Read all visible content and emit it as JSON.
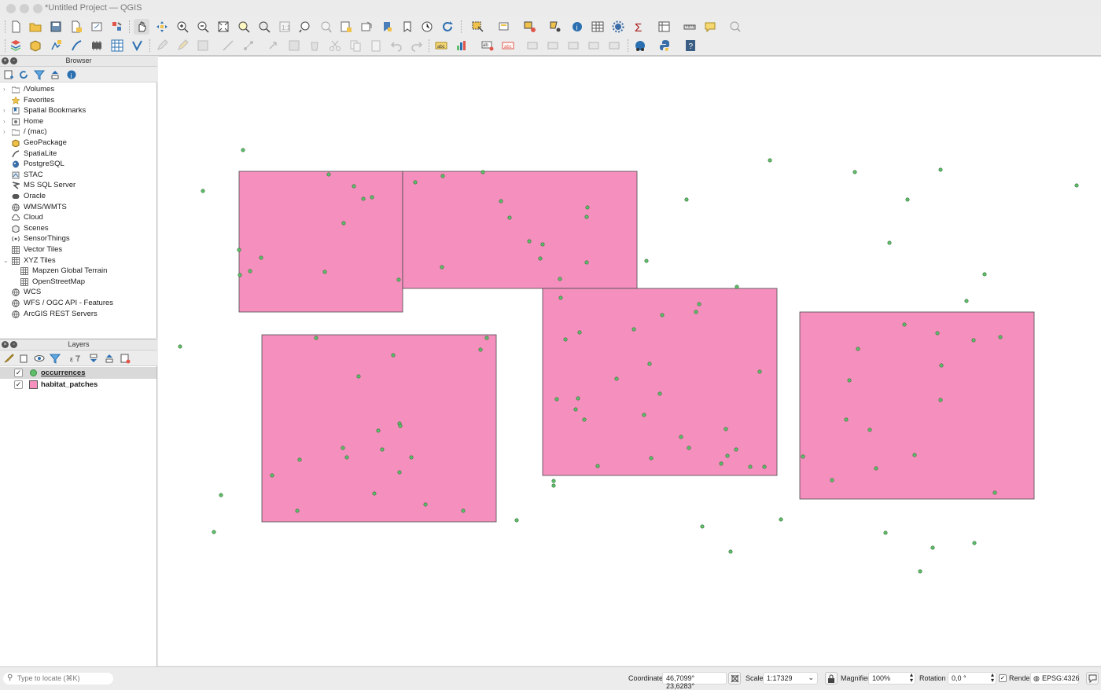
{
  "window": {
    "title": "*Untitled Project — QGIS"
  },
  "browser_panel": {
    "title": "Browser",
    "items": [
      {
        "label": "/Volumes",
        "icon": "folder-icon",
        "expandable": true
      },
      {
        "label": "Favorites",
        "icon": "star-icon",
        "expandable": false
      },
      {
        "label": "Spatial Bookmarks",
        "icon": "bookmark-icon",
        "expandable": true
      },
      {
        "label": "Home",
        "icon": "home-folder-icon",
        "expandable": true
      },
      {
        "label": "/ (mac)",
        "icon": "folder-icon",
        "expandable": true
      },
      {
        "label": "GeoPackage",
        "icon": "geopackage-icon",
        "expandable": false
      },
      {
        "label": "SpatiaLite",
        "icon": "spatialite-icon",
        "expandable": false
      },
      {
        "label": "PostgreSQL",
        "icon": "postgresql-icon",
        "expandable": false
      },
      {
        "label": "STAC",
        "icon": "stac-icon",
        "expandable": false
      },
      {
        "label": "MS SQL Server",
        "icon": "mssql-icon",
        "expandable": false
      },
      {
        "label": "Oracle",
        "icon": "oracle-icon",
        "expandable": false
      },
      {
        "label": "WMS/WMTS",
        "icon": "globe-icon",
        "expandable": false
      },
      {
        "label": "Cloud",
        "icon": "cloud-icon",
        "expandable": false
      },
      {
        "label": "Scenes",
        "icon": "scenes-icon",
        "expandable": false
      },
      {
        "label": "SensorThings",
        "icon": "sensor-icon",
        "expandable": false
      },
      {
        "label": "Vector Tiles",
        "icon": "grid-icon",
        "expandable": false
      },
      {
        "label": "XYZ Tiles",
        "icon": "grid-icon",
        "expandable": true,
        "expanded": true
      },
      {
        "label": "Mapzen Global Terrain",
        "icon": "grid-icon",
        "child": true
      },
      {
        "label": "OpenStreetMap",
        "icon": "grid-icon",
        "child": true
      },
      {
        "label": "WCS",
        "icon": "globe-icon",
        "expandable": false
      },
      {
        "label": "WFS / OGC API - Features",
        "icon": "globe-icon",
        "expandable": false
      },
      {
        "label": "ArcGIS REST Servers",
        "icon": "globe-icon",
        "expandable": false
      }
    ]
  },
  "layers_panel": {
    "title": "Layers",
    "layers": [
      {
        "name": "occurrences",
        "checked": true,
        "symbol": "point",
        "color": "#5fbf6a",
        "selected": true
      },
      {
        "name": "habitat_patches",
        "checked": true,
        "symbol": "polygon",
        "color": "#f48fbe",
        "selected": false
      }
    ]
  },
  "map": {
    "polygon_fill": "#f48fbe",
    "point_fill": "#5fbf6a",
    "polygon_count": 5,
    "point_count": 120
  },
  "status": {
    "locate_placeholder": "Type to locate (⌘K)",
    "coordinate_label": "Coordinate",
    "coordinate_value": "46,7099° 23,6283°",
    "scale_label": "Scale",
    "scale_value": "1:17329",
    "magnifier_label": "Magnifier",
    "magnifier_value": "100%",
    "rotation_label": "Rotation",
    "rotation_value": "0,0 °",
    "render_label": "Render",
    "render_checked": true,
    "crs_value": "EPSG:4326"
  }
}
